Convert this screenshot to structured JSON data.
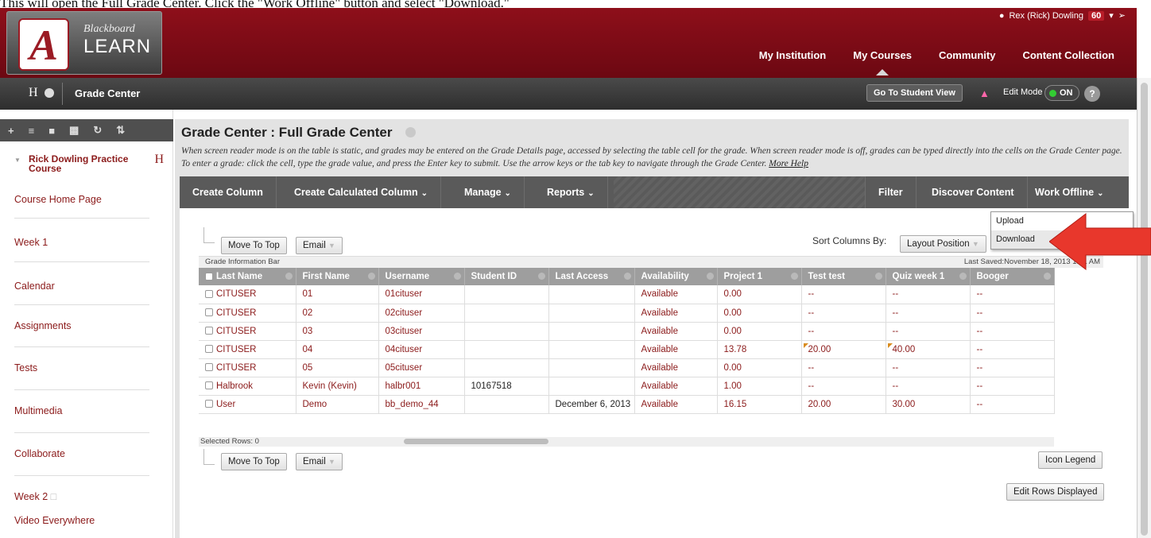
{
  "caption": "This will open the Full Grade Center. Click the \"Work Offline\" button and select \"Download.\"",
  "header": {
    "logo_bb": "Blackboard",
    "logo_learn": "LEARN",
    "logo_letter": "A",
    "user_name": "Rex (Rick) Dowling",
    "notifications": "60",
    "nav": [
      "My Institution",
      "My Courses",
      "Community",
      "Content Collection"
    ],
    "active_nav": "My Courses"
  },
  "course_bar": {
    "course_letter": "H",
    "page": "Grade Center",
    "student_view": "Go To Student View",
    "edit_mode_label": "Edit Mode is:",
    "edit_mode_value": "ON",
    "help": "?"
  },
  "sidebar": {
    "course_name": "Rick Dowling Practice Course",
    "course_letter": "H",
    "items": [
      "Course Home Page",
      "Week 1",
      "Calendar",
      "Assignments",
      "Tests",
      "Multimedia",
      "Collaborate",
      "Week 2",
      "Video Everywhere"
    ]
  },
  "main": {
    "title": "Grade Center : Full Grade Center",
    "description": "When screen reader mode is on the table is static, and grades may be entered on the Grade Details page, accessed by selecting the table cell for the grade. When screen reader mode is off, grades can be typed directly into the cells on the Grade Center page. To enter a grade: click the cell, type the grade value, and press the Enter key to submit. Use the arrow keys or the tab key to navigate through the Grade Center.",
    "more_help": "More Help",
    "actions": {
      "create_column": "Create Column",
      "create_calculated": "Create Calculated Column",
      "manage": "Manage",
      "reports": "Reports",
      "filter": "Filter",
      "discover": "Discover Content",
      "work_offline": "Work Offline"
    },
    "work_offline_menu": [
      "Upload",
      "Download"
    ],
    "move_to_top": "Move To Top",
    "email": "Email",
    "sort_by_label": "Sort Columns By:",
    "sort_by_value": "Layout Position",
    "info_bar": "Grade Information Bar",
    "last_saved": "Last Saved:November 18, 2013 1:51 AM",
    "selected_rows": "Selected Rows: 0",
    "icon_legend": "Icon Legend",
    "edit_rows": "Edit Rows Displayed"
  },
  "grid": {
    "columns": [
      "Last Name",
      "First Name",
      "Username",
      "Student ID",
      "Last Access",
      "Availability",
      "Project 1",
      "Test test",
      "Quiz week 1",
      "Booger"
    ],
    "rows": [
      [
        "CITUSER",
        "01",
        "01cituser",
        "",
        "",
        "Available",
        "0.00",
        "--",
        "--",
        "--"
      ],
      [
        "CITUSER",
        "02",
        "02cituser",
        "",
        "",
        "Available",
        "0.00",
        "--",
        "--",
        "--"
      ],
      [
        "CITUSER",
        "03",
        "03cituser",
        "",
        "",
        "Available",
        "0.00",
        "--",
        "--",
        "--"
      ],
      [
        "CITUSER",
        "04",
        "04cituser",
        "",
        "",
        "Available",
        "13.78",
        "20.00",
        "40.00",
        "--"
      ],
      [
        "CITUSER",
        "05",
        "05cituser",
        "",
        "",
        "Available",
        "0.00",
        "--",
        "--",
        "--"
      ],
      [
        "Halbrook",
        "Kevin (Kevin)",
        "halbr001",
        "10167518",
        "",
        "Available",
        "1.00",
        "--",
        "--",
        "--"
      ],
      [
        "User",
        "Demo",
        "bb_demo_44",
        "",
        "December 6, 2013",
        "Available",
        "16.15",
        "20.00",
        "30.00",
        "--"
      ]
    ],
    "flagged_row": 3
  },
  "colors": {
    "header_red": "#8e0f1a",
    "link_red": "#8b1a1a",
    "arrow_red": "#e8372c",
    "action_bar": "#5a5a5a",
    "grid_header": "#9e9e9e"
  }
}
